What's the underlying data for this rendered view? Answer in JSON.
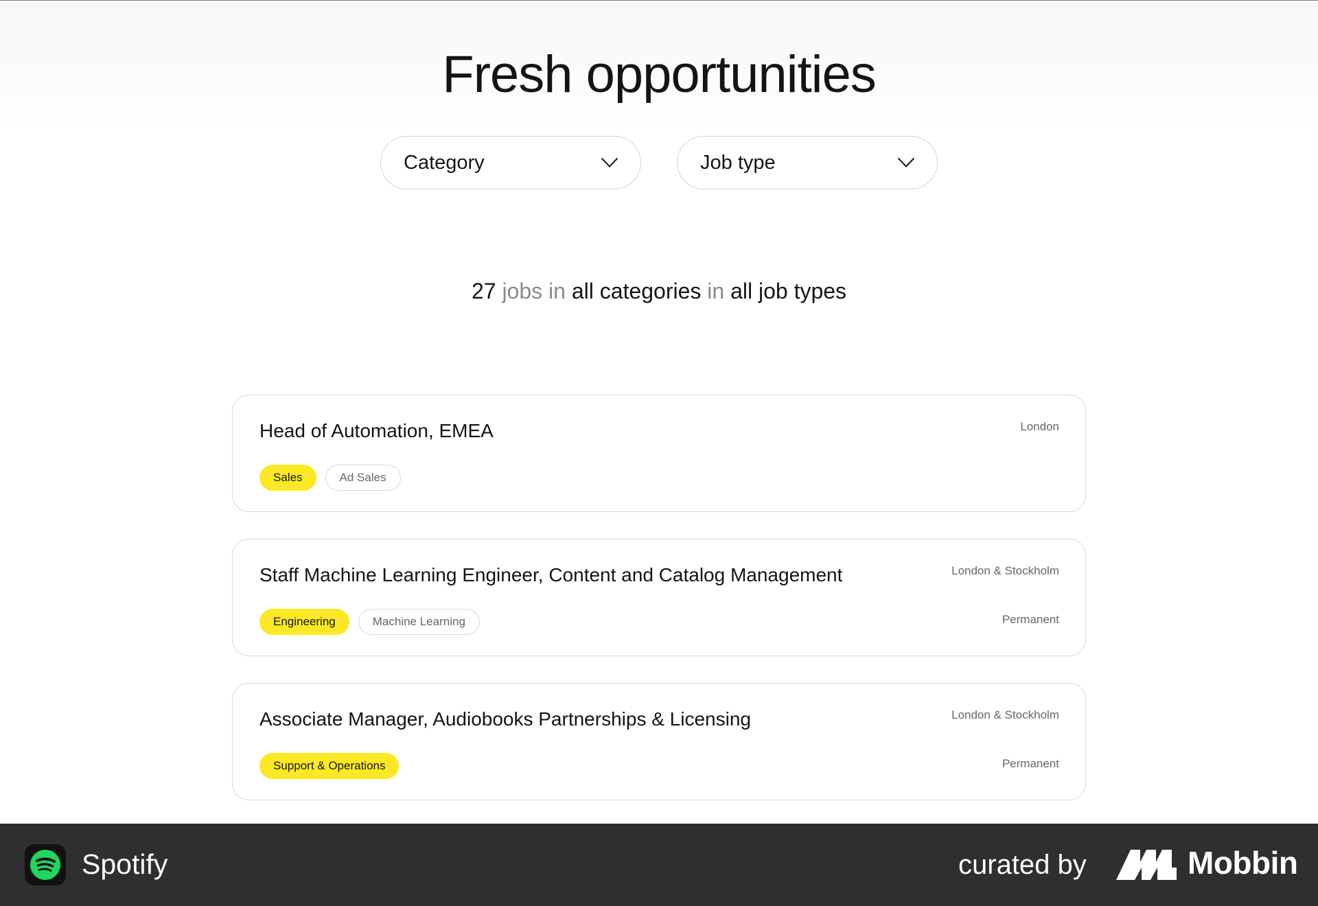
{
  "header": {
    "title": "Fresh opportunities"
  },
  "filters": {
    "category": {
      "label": "Category",
      "icon": "chevron-down-icon"
    },
    "job_type": {
      "label": "Job type",
      "icon": "chevron-down-icon"
    }
  },
  "summary": {
    "count": "27",
    "jobs_word": "jobs",
    "in_1": "in",
    "categories": "all categories",
    "in_2": "in",
    "job_types": "all job types"
  },
  "jobs": [
    {
      "title": "Head of Automation, EMEA",
      "location": "London",
      "type": "",
      "primary_tag": "Sales",
      "secondary_tag": "Ad Sales"
    },
    {
      "title": "Staff Machine Learning Engineer, Content and Catalog Management",
      "location": "London & Stockholm",
      "type": "Permanent",
      "primary_tag": "Engineering",
      "secondary_tag": "Machine Learning"
    },
    {
      "title": "Associate Manager, Audiobooks Partnerships & Licensing",
      "location": "London & Stockholm",
      "type": "Permanent",
      "primary_tag": "Support & Operations"
    }
  ],
  "footer": {
    "app_name": "Spotify",
    "app_icon": "spotify-logo-icon",
    "curated_by": "curated by",
    "brand_name": "Mobbin",
    "brand_icon": "mobbin-logo-icon"
  },
  "colors": {
    "tag_primary": "#fde825",
    "footer_bg": "#2f2f2f",
    "spotify_green": "#1ed760"
  }
}
